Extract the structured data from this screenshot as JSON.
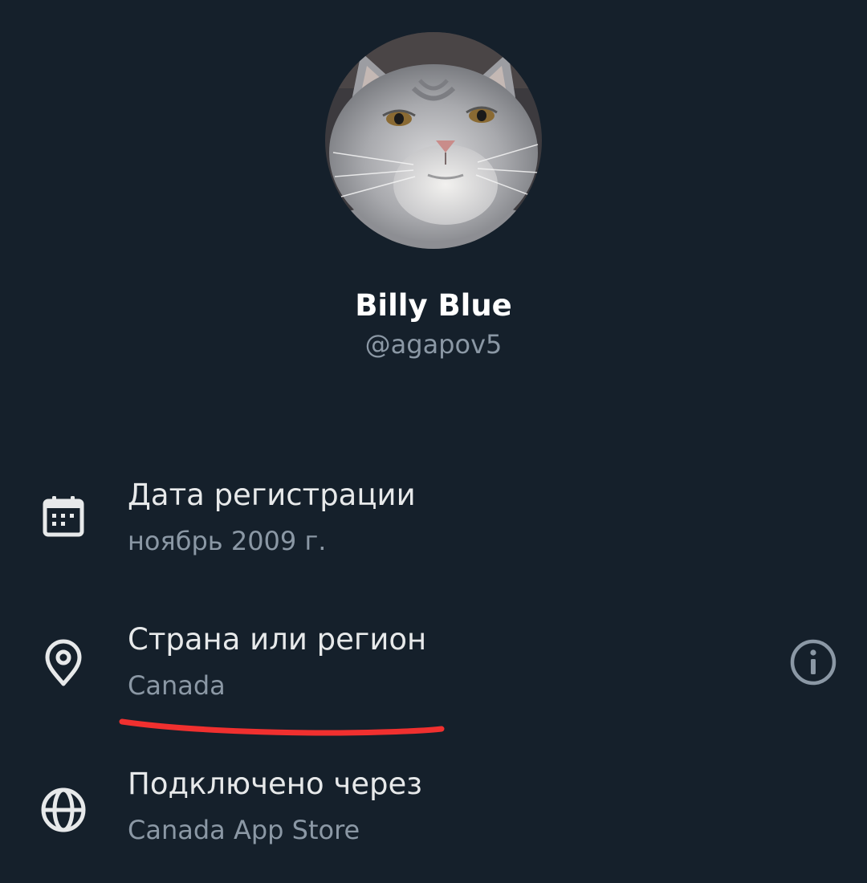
{
  "profile": {
    "display_name": "Billy Blue",
    "handle": "@agapov5",
    "avatar_icon": "cat-photo-avatar"
  },
  "about": [
    {
      "icon": "calendar-icon",
      "label": "Дата регистрации",
      "value": "ноябрь 2009 г."
    },
    {
      "icon": "location-pin-icon",
      "label": "Страна или регион",
      "value": "Canada",
      "action_icon": "info-icon"
    },
    {
      "icon": "globe-icon",
      "label": "Подключено через",
      "value": "Canada App Store"
    }
  ],
  "colors": {
    "background": "#15202b",
    "primary_text": "#e7e9ea",
    "secondary_text": "#8b98a5",
    "annotation": "#f0302f"
  }
}
